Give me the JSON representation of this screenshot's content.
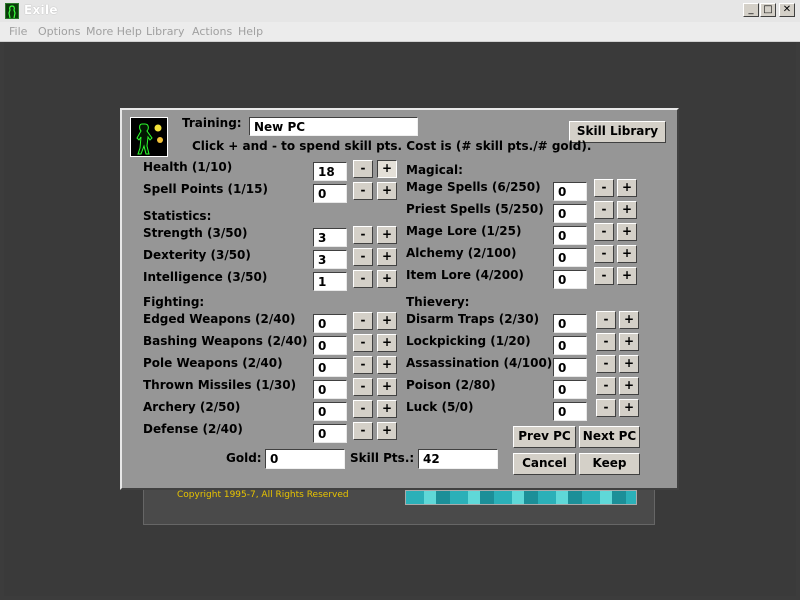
{
  "window": {
    "title": "Exile",
    "minimize": "_",
    "maximize": "□",
    "close": "✕"
  },
  "menu": [
    "File",
    "Options",
    "More Help",
    "Library",
    "Actions",
    "Help"
  ],
  "footer": {
    "copyright": "Copyright 1995-7, All Rights Reserved"
  },
  "dialog": {
    "training_label": "Training:",
    "pc_name": "New PC",
    "instructions": "Click + and - to spend skill pts. Cost is (# skill pts./# gold).",
    "skill_library": "Skill Library",
    "sections": {
      "magical": "Magical:",
      "statistics": "Statistics:",
      "fighting": "Fighting:",
      "thievery": "Thievery:"
    },
    "left_skills": [
      {
        "label": "Health (1/10)",
        "value": "18"
      },
      {
        "label": "Spell Points (1/15)",
        "value": "0"
      },
      {
        "label": "Strength (3/50)",
        "value": "3"
      },
      {
        "label": "Dexterity (3/50)",
        "value": "3"
      },
      {
        "label": "Intelligence (3/50)",
        "value": "1"
      },
      {
        "label": "Edged Weapons (2/40)",
        "value": "0"
      },
      {
        "label": "Bashing Weapons (2/40)",
        "value": "0"
      },
      {
        "label": "Pole Weapons (2/40)",
        "value": "0"
      },
      {
        "label": "Thrown Missiles (1/30)",
        "value": "0"
      },
      {
        "label": "Archery (2/50)",
        "value": "0"
      },
      {
        "label": "Defense (2/40)",
        "value": "0"
      }
    ],
    "right_skills": [
      {
        "label": "Mage Spells (6/250)",
        "value": "0"
      },
      {
        "label": "Priest Spells (5/250)",
        "value": "0"
      },
      {
        "label": "Mage Lore (1/25)",
        "value": "0"
      },
      {
        "label": "Alchemy (2/100)",
        "value": "0"
      },
      {
        "label": "Item Lore (4/200)",
        "value": "0"
      },
      {
        "label": "Disarm Traps (2/30)",
        "value": "0"
      },
      {
        "label": "Lockpicking (1/20)",
        "value": "0"
      },
      {
        "label": "Assassination (4/100)",
        "value": "0"
      },
      {
        "label": "Poison (2/80)",
        "value": "0"
      },
      {
        "label": "Luck (5/0)",
        "value": "0"
      }
    ],
    "minus": "-",
    "plus": "+",
    "gold_label": "Gold:",
    "gold_value": "0",
    "skill_pts_label": "Skill Pts.:",
    "skill_pts_value": "42",
    "prev_pc": "Prev PC",
    "next_pc": "Next PC",
    "cancel": "Cancel",
    "keep": "Keep"
  }
}
